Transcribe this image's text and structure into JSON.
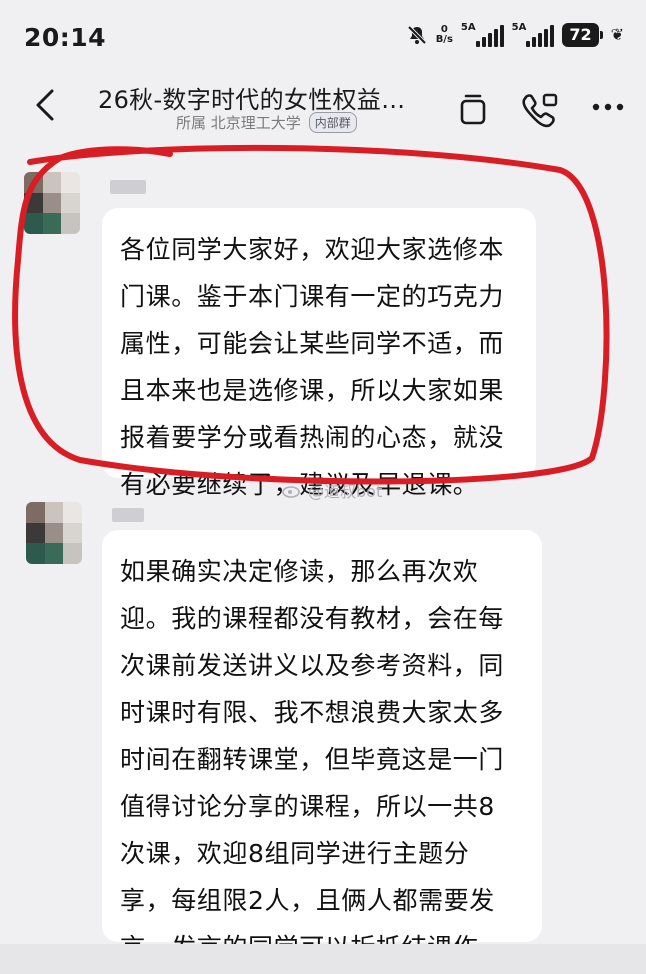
{
  "status": {
    "time": "20:14",
    "speed_value": "0",
    "speed_unit": "B/s",
    "sim1_label": "5A",
    "sim2_label": "5A",
    "battery": "72"
  },
  "header": {
    "title": "26秋-数字时代的女性权益…",
    "org_label": "所属 北京理工大学",
    "badge": "内部群"
  },
  "messages": [
    {
      "text": "各位同学大家好，欢迎大家选修本\n门课。鉴于本门课有一定的巧克力\n属性，可能会让某些同学不适，而\n且本来也是选修课，所以大家如果\n报着要学分或看热闹的心态，就没\n有必要继续了，建议及早退课。"
    },
    {
      "text": "如果确实决定修读，那么再次欢\n迎。我的课程都没有教材，会在每\n次课前发送讲义以及参考资料，同\n时课时有限、我不想浪费大家太多\n时间在翻转课堂，但毕竟这是一门\n值得讨论分享的课程，所以一共8\n次课，欢迎8组同学进行主题分\n享，每组限2人，且俩人都需要发\n言，发言的同学可以折抵结课作\n业。"
    }
  ],
  "watermark": "@道叔bot",
  "colors": {
    "background": "#f0f0f2",
    "bubble": "#ffffff",
    "annotation_red": "#d81e24"
  }
}
